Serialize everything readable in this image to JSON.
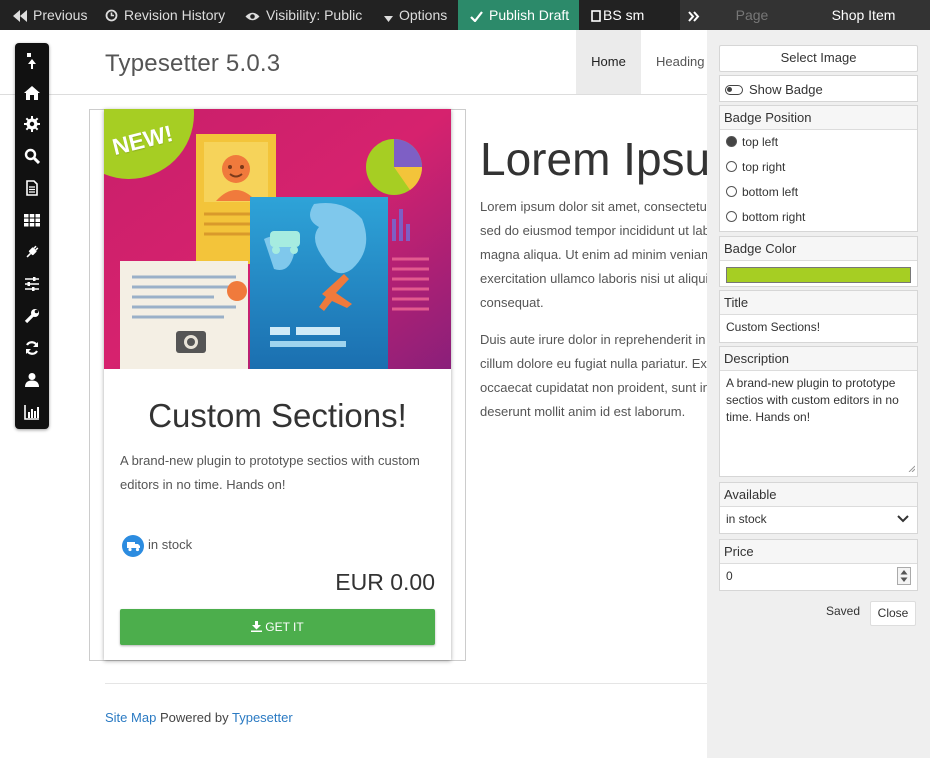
{
  "toolbar": {
    "previous": "Previous",
    "revision_history": "Revision History",
    "visibility": "Visibility: Public",
    "options": "Options",
    "publish_draft": "Publish Draft",
    "bs_size": "BS sm",
    "page_tab": "Page",
    "shop_item_tab": "Shop Item"
  },
  "site": {
    "brand": "Typesetter 5.0.3",
    "nav": [
      "Home",
      "Heading"
    ]
  },
  "card": {
    "badge": "NEW!",
    "title": "Custom Sections!",
    "description": "A brand-new plugin to prototype sectios with custom editors in no time. Hands on!",
    "stock": "in stock",
    "price": "EUR 0.00",
    "button": "GET IT"
  },
  "lorem": {
    "title": "Lorem Ipsum",
    "p1": [
      "Lorem ipsum dolor sit amet, consectetur adipiscing elit,",
      "sed do eiusmod tempor incididunt ut labore et dolore",
      "magna aliqua. Ut enim ad minim veniam, quis nostrud",
      "exercitation ullamco laboris nisi ut aliquip ex ea commodo",
      "consequat."
    ],
    "p2": [
      "Duis aute irure dolor in reprehenderit in voluptate velit esse",
      "cillum dolore eu fugiat nulla pariatur. Excepteur sint",
      "occaecat cupidatat non proident, sunt in culpa qui officia",
      "deserunt mollit anim id est laborum."
    ]
  },
  "footer": {
    "sitemap": "Site Map",
    "powered_by": "Powered by",
    "typesetter": "Typesetter"
  },
  "panel": {
    "select_image": "Select Image",
    "show_badge": "Show Badge",
    "badge_position_label": "Badge Position",
    "badge_positions": [
      "top left",
      "top right",
      "bottom left",
      "bottom right"
    ],
    "badge_position_selected": "top left",
    "badge_color_label": "Badge Color",
    "badge_color": "#a6ce23",
    "title_label": "Title",
    "title_value": "Custom Sections!",
    "description_label": "Description",
    "description_value": "A brand-new plugin to prototype sectios with custom editors in no time. Hands on!",
    "available_label": "Available",
    "available_value": "in stock",
    "price_label": "Price",
    "price_value": "0",
    "saved": "Saved",
    "close": "Close"
  },
  "colors": {
    "publish_bg": "#2c8a6a",
    "badge": "#a6ce23",
    "button_green": "#4cae4c",
    "link": "#2a7ac3"
  }
}
